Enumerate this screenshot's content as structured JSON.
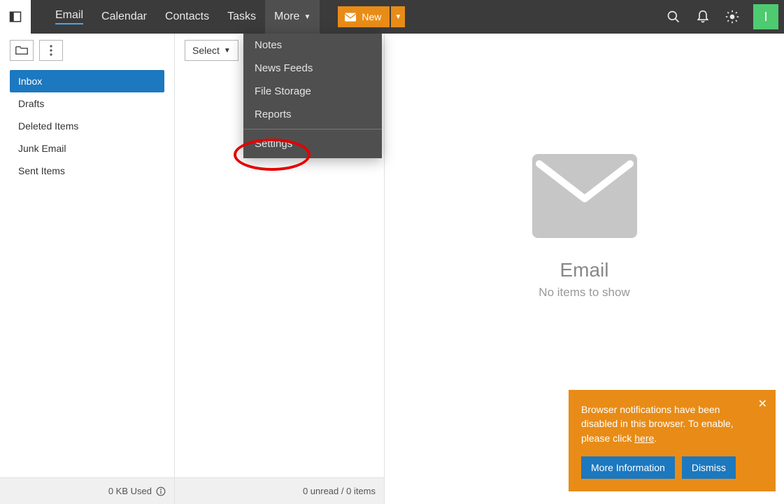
{
  "nav": {
    "email": "Email",
    "calendar": "Calendar",
    "contacts": "Contacts",
    "tasks": "Tasks",
    "more": "More"
  },
  "newButton": "New",
  "avatarInitial": "I",
  "sidebar": {
    "folders": {
      "inbox": "Inbox",
      "drafts": "Drafts",
      "deleted": "Deleted Items",
      "junk": "Junk Email",
      "sent": "Sent Items"
    },
    "storage": "0 KB Used"
  },
  "list": {
    "selectLabel": "Select",
    "status": "0 unread / 0 items"
  },
  "dropdown": {
    "notes": "Notes",
    "newsFeeds": "News Feeds",
    "fileStorage": "File Storage",
    "reports": "Reports",
    "settings": "Settings"
  },
  "empty": {
    "title": "Email",
    "subtitle": "No items to show"
  },
  "toast": {
    "textBefore": "Browser notifications have been disabled in this browser. To enable, please click ",
    "linkText": "here",
    "textAfter": ".",
    "moreInfo": "More Information",
    "dismiss": "Dismiss"
  }
}
